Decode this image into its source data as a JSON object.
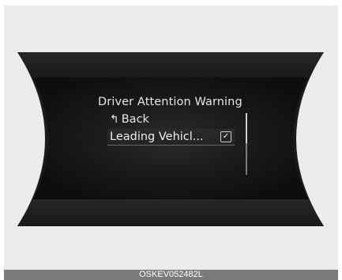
{
  "menu": {
    "title": "Driver Attention Warning",
    "back_label": "Back",
    "items": [
      {
        "label": "Leading Vehicl...",
        "checked": true
      }
    ],
    "check_glyph": "✓",
    "back_glyph": "↰"
  },
  "caption": "OSKEV052482L",
  "colors": {
    "bezel": "#1b1b1b",
    "screen_center": "#1a1a1a",
    "text": "#e6e6e6",
    "caption_bar": "#7b7b7b",
    "frame": "#ececec"
  }
}
